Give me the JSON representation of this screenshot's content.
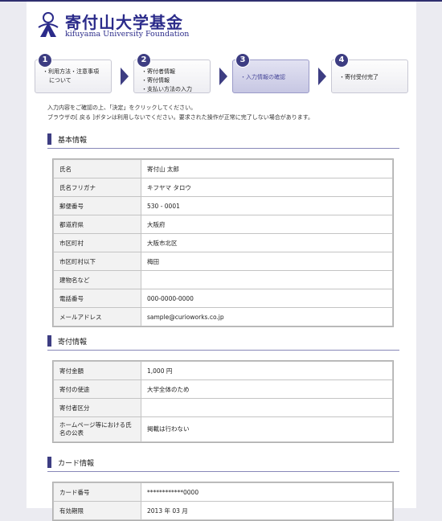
{
  "header": {
    "logo_jp": "寄付山大学基金",
    "logo_en": "kifuyama University Foundation"
  },
  "steps": [
    {
      "num": "1",
      "lines": [
        "・利用方法・注意事項",
        "について"
      ]
    },
    {
      "num": "2",
      "lines": [
        "・寄付者情報",
        "・寄付情報",
        "・支払い方法の入力"
      ]
    },
    {
      "num": "3",
      "lines": [
        "・入力情報の確認"
      ]
    },
    {
      "num": "4",
      "lines": [
        "・寄付受付完了"
      ]
    }
  ],
  "notice": {
    "line1": "入力内容をご確認の上、「決定」をクリックしてください。",
    "line2": "ブラウザの[ 戻る ]ボタンは利用しないでください。要求された操作が正常に完了しない場合があります。"
  },
  "basic": {
    "heading": "基本情報",
    "rows": [
      {
        "label": "氏名",
        "value": "寄付山 太郎"
      },
      {
        "label": "氏名フリガナ",
        "value": "キフヤマ タロウ"
      },
      {
        "label": "郵便番号",
        "value": "530 - 0001"
      },
      {
        "label": "都道府県",
        "value": "大阪府"
      },
      {
        "label": "市区町村",
        "value": "大阪市北区"
      },
      {
        "label": "市区町村以下",
        "value": "梅田"
      },
      {
        "label": "建物名など",
        "value": ""
      },
      {
        "label": "電話番号",
        "value": "000-0000-0000"
      },
      {
        "label": "メールアドレス",
        "value": "sample@curioworks.co.jp"
      }
    ]
  },
  "donation": {
    "heading": "寄付情報",
    "rows": [
      {
        "label": "寄付金額",
        "value": "1,000 円"
      },
      {
        "label": "寄付の使途",
        "value": "大学全体のため"
      },
      {
        "label": "寄付者区分",
        "value": ""
      },
      {
        "label": "ホームページ等における氏名の公表",
        "value": "掲載は行わない"
      }
    ]
  },
  "card": {
    "heading": "カード情報",
    "rows": [
      {
        "label": "カード番号",
        "value": "************0000"
      },
      {
        "label": "有効期限",
        "value": "2013 年 03 月"
      }
    ]
  },
  "colors": {
    "accent": "#3d3d82",
    "logo": "#2b2b8a",
    "background": "#ebebf1"
  }
}
